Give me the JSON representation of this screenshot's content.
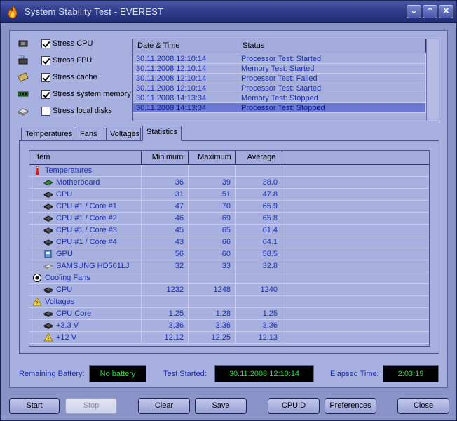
{
  "window": {
    "title": "System Stability Test - EVEREST"
  },
  "stress": [
    {
      "label": "Stress CPU",
      "checked": true,
      "icon": "cpu-chip-icon"
    },
    {
      "label": "Stress FPU",
      "checked": true,
      "icon": "fpu-chip-icon"
    },
    {
      "label": "Stress cache",
      "checked": true,
      "icon": "cache-memory-icon"
    },
    {
      "label": "Stress system memory",
      "checked": true,
      "icon": "ram-module-icon"
    },
    {
      "label": "Stress local disks",
      "checked": false,
      "icon": "hard-disk-icon"
    }
  ],
  "log": {
    "headers": [
      "Date & Time",
      "Status"
    ],
    "rows": [
      {
        "date": "30.11.2008 12:10:14",
        "status": "Processor Test: Started"
      },
      {
        "date": "30.11.2008 12:10:14",
        "status": "Memory Test: Started"
      },
      {
        "date": "30.11.2008 12:10:14",
        "status": "Processor Test: Failed"
      },
      {
        "date": "30.11.2008 12:10:14",
        "status": "Processor Test: Started"
      },
      {
        "date": "30.11.2008 14:13:34",
        "status": "Memory Test: Stopped"
      },
      {
        "date": "30.11.2008 14:13:34",
        "status": "Processor Test: Stopped"
      }
    ]
  },
  "tabs": [
    "Temperatures",
    "Fans",
    "Voltages",
    "Statistics"
  ],
  "stats": {
    "headers": [
      "Item",
      "Minimum",
      "Maximum",
      "Average"
    ],
    "rows": [
      {
        "kind": "group",
        "icon": "thermometer-icon",
        "item": "Temperatures",
        "min": "",
        "max": "",
        "avg": ""
      },
      {
        "kind": "sub",
        "icon": "motherboard-icon",
        "item": "Motherboard",
        "min": "36",
        "max": "39",
        "avg": "38.0"
      },
      {
        "kind": "sub",
        "icon": "cpu-chip-icon",
        "item": "CPU",
        "min": "31",
        "max": "51",
        "avg": "47.8"
      },
      {
        "kind": "sub",
        "icon": "cpu-chip-icon",
        "item": "CPU #1 / Core #1",
        "min": "47",
        "max": "70",
        "avg": "65.9"
      },
      {
        "kind": "sub",
        "icon": "cpu-chip-icon",
        "item": "CPU #1 / Core #2",
        "min": "46",
        "max": "69",
        "avg": "65.8"
      },
      {
        "kind": "sub",
        "icon": "cpu-chip-icon",
        "item": "CPU #1 / Core #3",
        "min": "45",
        "max": "65",
        "avg": "61.4"
      },
      {
        "kind": "sub",
        "icon": "cpu-chip-icon",
        "item": "CPU #1 / Core #4",
        "min": "43",
        "max": "66",
        "avg": "64.1"
      },
      {
        "kind": "sub",
        "icon": "gpu-icon",
        "item": "GPU",
        "min": "56",
        "max": "60",
        "avg": "58.5"
      },
      {
        "kind": "sub",
        "icon": "hard-disk-icon",
        "item": "SAMSUNG HD501LJ",
        "min": "32",
        "max": "33",
        "avg": "32.8"
      },
      {
        "kind": "group",
        "icon": "fan-icon",
        "item": "Cooling Fans",
        "min": "",
        "max": "",
        "avg": ""
      },
      {
        "kind": "sub",
        "icon": "cpu-chip-icon",
        "item": "CPU",
        "min": "1232",
        "max": "1248",
        "avg": "1240"
      },
      {
        "kind": "group",
        "icon": "voltage-icon",
        "item": "Voltages",
        "min": "",
        "max": "",
        "avg": ""
      },
      {
        "kind": "sub",
        "icon": "cpu-chip-icon",
        "item": "CPU Core",
        "min": "1.25",
        "max": "1.28",
        "avg": "1.25"
      },
      {
        "kind": "sub",
        "icon": "cpu-chip-icon",
        "item": "+3.3 V",
        "min": "3.36",
        "max": "3.36",
        "avg": "3.36"
      },
      {
        "kind": "sub",
        "icon": "voltage-icon",
        "item": "+12 V",
        "min": "12.12",
        "max": "12.25",
        "avg": "12.13"
      }
    ]
  },
  "info": {
    "battery_label": "Remaining Battery:",
    "battery_value": "No battery",
    "started_label": "Test Started:",
    "started_value": "30.11.2008 12:10:14",
    "elapsed_label": "Elapsed Time:",
    "elapsed_value": "2:03:19"
  },
  "buttons": {
    "start": "Start",
    "stop": "Stop",
    "clear": "Clear",
    "save": "Save",
    "cpuid": "CPUID",
    "preferences": "Preferences",
    "close": "Close"
  },
  "colors": {
    "accent": "#1a2fb0",
    "selection": "#6a78d4",
    "display_text": "#23e23c"
  }
}
